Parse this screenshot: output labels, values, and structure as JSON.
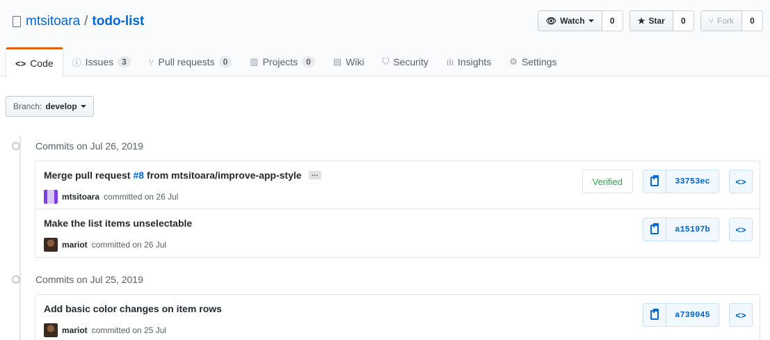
{
  "repo": {
    "owner": "mtsitoara",
    "separator": "/",
    "name": "todo-list"
  },
  "actions": {
    "watch": {
      "label": "Watch",
      "count": "0"
    },
    "star": {
      "label": "Star",
      "count": "0"
    },
    "fork": {
      "label": "Fork",
      "count": "0"
    }
  },
  "tabs": [
    {
      "icon": "<>",
      "label": "Code",
      "count": ""
    },
    {
      "icon": "ⓘ",
      "label": "Issues",
      "count": "3"
    },
    {
      "icon": "⑂",
      "label": "Pull requests",
      "count": "0"
    },
    {
      "icon": "▥",
      "label": "Projects",
      "count": "0"
    },
    {
      "icon": "▤",
      "label": "Wiki",
      "count": ""
    },
    {
      "icon": "⛉",
      "label": "Security",
      "count": ""
    },
    {
      "icon": "ılı",
      "label": "Insights",
      "count": ""
    },
    {
      "icon": "⚙",
      "label": "Settings",
      "count": ""
    }
  ],
  "branch": {
    "prefix": "Branch:",
    "name": "develop"
  },
  "groups": [
    {
      "title": "Commits on Jul 26, 2019",
      "commits": [
        {
          "message_pre": "Merge pull request ",
          "pr": "#8",
          "message_post": " from mtsitoara/improve-app-style",
          "has_ellipsis": true,
          "ellipsis": "…",
          "author": "mtsitoara",
          "meta": "committed on 26 Jul",
          "verified": "Verified",
          "sha": "33753ec",
          "browse": "<>"
        },
        {
          "message_pre": "Make the list items unselectable",
          "pr": "",
          "message_post": "",
          "author": "mariot",
          "meta": "committed on 26 Jul",
          "verified": "",
          "sha": "a15197b",
          "browse": "<>"
        }
      ]
    },
    {
      "title": "Commits on Jul 25, 2019",
      "commits": [
        {
          "message_pre": "Add basic color changes on item rows",
          "pr": "",
          "message_post": "",
          "author": "mariot",
          "meta": "committed on 25 Jul",
          "verified": "",
          "sha": "a739045",
          "browse": "<>"
        }
      ]
    }
  ]
}
